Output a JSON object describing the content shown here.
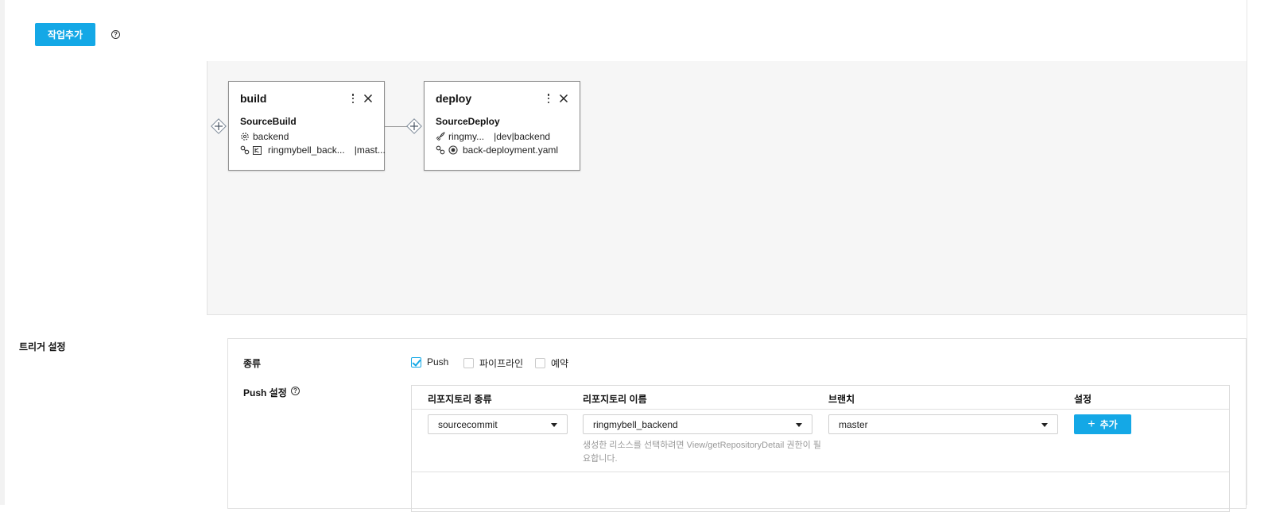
{
  "toolbar": {
    "add_job_label": "작업추가",
    "help_glyph": "?"
  },
  "pipeline": {
    "jobs": [
      {
        "title": "build",
        "type": "SourceBuild",
        "row1": "backend",
        "row2": "ringmybell_back...",
        "row2_suffix": "|mast...",
        "row1_icon": "gear-icon",
        "row2_icon": "repository-icon"
      },
      {
        "title": "deploy",
        "type": "SourceDeploy",
        "row1": "ringmy...",
        "row1_suffix": "|dev|backend",
        "row2": "back-deployment.yaml",
        "row1_icon": "rocket-icon",
        "row2_icon": "manifest-icon"
      }
    ]
  },
  "trigger": {
    "section_label": "트리거 설정",
    "type_label": "종류",
    "options": [
      {
        "label": "Push",
        "checked": true
      },
      {
        "label": "파이프라인",
        "checked": false
      },
      {
        "label": "예약",
        "checked": false
      }
    ],
    "push_settings_label": "Push 설정",
    "table": {
      "headers": [
        "리포지토리 종류",
        "리포지토리 이름",
        "브랜치",
        "설정"
      ],
      "repo_type_value": "sourcecommit",
      "repo_name_value": "ringmybell_backend",
      "branch_value": "master",
      "add_button_label": "추가",
      "hint": "생성한 리소스를 선택하려면 View/getRepositoryDetail 권한이 필요합니다."
    }
  },
  "colors": {
    "accent": "#14a8e6",
    "canvas_bg": "#f6f6f6"
  }
}
